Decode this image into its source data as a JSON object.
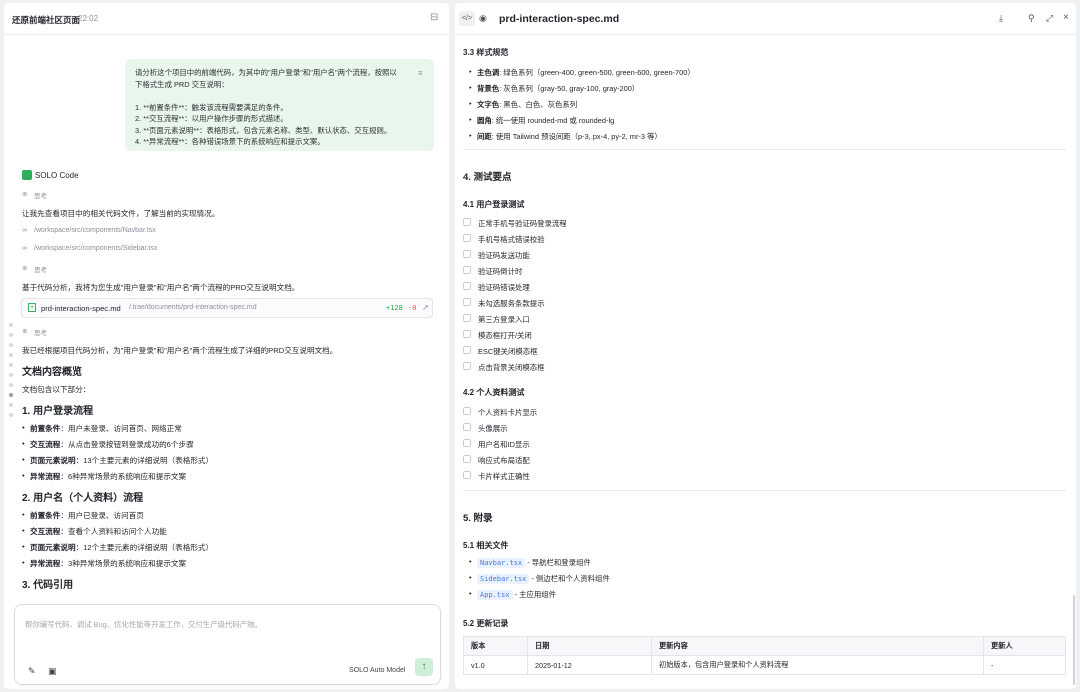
{
  "left_pane": {
    "title": "还原前端社区页面",
    "time": "22:02",
    "user_message": {
      "lines": [
        "请分析这个项目中的前端代码，为其中的\"用户登录\"和\"用户名\"两个流程，按照以",
        "下格式生成 PRD 交互说明：",
        "",
        "1.  **前置条件**：触发该流程需要满足的条件。",
        "2.  **交互流程**：以用户操作步骤的形式描述。",
        "3.  **页面元素说明**：表格形式，包含元素名称、类型、默认状态、交互规则。",
        "4.  **异常流程**：各种错误场景下的系统响应和提示文案。"
      ]
    },
    "agent_name": "SOLO Code",
    "think1": "思考",
    "line1": "让我先查看项目中的相关代码文件，了解当前的实现情况。",
    "file1": "/workspace/src/components/Navbar.tsx",
    "file2": "/workspace/src/components/Sidebar.tsx",
    "think2": "思考",
    "line2": "基于代码分析，我将为您生成\"用户登录\"和\"用户名\"两个流程的PRD交互说明文档。",
    "chip": {
      "name": "prd-interaction-spec.md",
      "path": "/.trae/documents/prd-interaction-spec.md",
      "added": "+128",
      "removed": "-0"
    },
    "think3": "思考",
    "line3": "我已经根据项目代码分析，为\"用户登录\"和\"用户名\"两个流程生成了详细的PRD交互说明文档。",
    "overview_title": "文档内容概览",
    "overview_sub": "文档包含以下部分：",
    "sec1_title": "1. 用户登录流程",
    "sec1_items": [
      {
        "k": "前置条件",
        "v": "：用户未登录、访问首页、网络正常"
      },
      {
        "k": "交互流程",
        "v": "：从点击登录按钮到登录成功的6个步骤"
      },
      {
        "k": "页面元素说明",
        "v": "：13个主要元素的详细说明（表格形式）"
      },
      {
        "k": "异常流程",
        "v": "：6种异常场景的系统响应和提示文案"
      }
    ],
    "sec2_title": "2. 用户名（个人资料）流程",
    "sec2_items": [
      {
        "k": "前置条件",
        "v": "：用户已登录、访问首页"
      },
      {
        "k": "交互流程",
        "v": "：查看个人资料和访问个人功能"
      },
      {
        "k": "页面元素说明",
        "v": "：12个主要元素的详细说明（表格形式）"
      },
      {
        "k": "异常流程",
        "v": "：3种异常场景的系统响应和提示文案"
      }
    ],
    "sec3_title": "3. 代码引用",
    "input_placeholder": "帮你编写代码、调试 Bug、优化性能等开发工作，交付生产级代码产物。",
    "model": "SOLO Auto Model"
  },
  "right_pane": {
    "filename": "prd-interaction-spec.md",
    "s33_title": "3.3 样式规范",
    "s33_items": [
      {
        "k": "主色调",
        "v": ": 绿色系列（green-400, green-500, green-600, green-700）"
      },
      {
        "k": "背景色",
        "v": ": 灰色系列（gray-50, gray-100, gray-200）"
      },
      {
        "k": "文字色",
        "v": ": 黑色、白色、灰色系列"
      },
      {
        "k": "圆角",
        "v": ": 统一使用 rounded-md 或 rounded-lg"
      },
      {
        "k": "间距",
        "v": ": 使用 Tailwind 预设间距（p-3, px-4, py-2, mr-3 等）"
      }
    ],
    "s4_title": "4. 测试要点",
    "s41_title": "4.1 用户登录测试",
    "s41_items": [
      "正常手机号验证码登录流程",
      "手机号格式错误校验",
      "验证码发送功能",
      "验证码倒计时",
      "验证码错误处理",
      "未勾选服务条款提示",
      "第三方登录入口",
      "模态框打开/关闭",
      "ESC键关闭模态框",
      "点击背景关闭模态框"
    ],
    "s42_title": "4.2 个人资料测试",
    "s42_items": [
      "个人资料卡片显示",
      "头像展示",
      "用户名和ID显示",
      "响应式布局适配",
      "卡片样式正确性"
    ],
    "s5_title": "5. 附录",
    "s51_title": "5.1 相关文件",
    "s51_items": [
      {
        "code": "Navbar.tsx",
        "v": " - 导航栏和登录组件"
      },
      {
        "code": "Sidebar.tsx",
        "v": " - 侧边栏和个人资料组件"
      },
      {
        "code": "App.tsx",
        "v": " - 主应用组件"
      }
    ],
    "s52_title": "5.2 更新记录",
    "table": {
      "headers": [
        "版本",
        "日期",
        "更新内容",
        "更新人"
      ],
      "rows": [
        [
          "v1.0",
          "2025-01-12",
          "初始版本，包含用户登录和个人资料流程",
          "-"
        ]
      ]
    }
  }
}
